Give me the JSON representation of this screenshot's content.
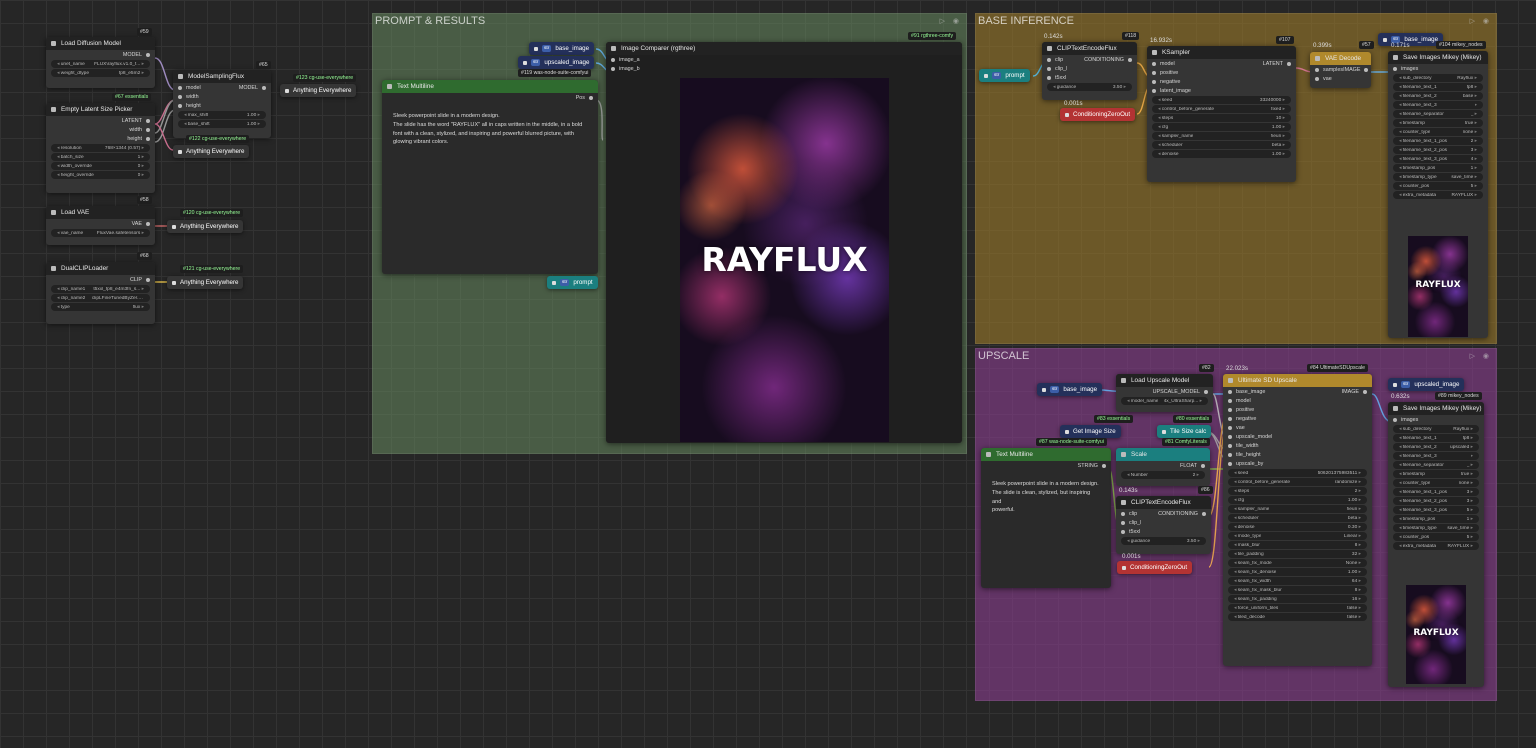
{
  "colors": {
    "prompt_group": "#66885f",
    "base_group": "#9b7a2a",
    "upscale_group": "#8a3d8f",
    "teal": "#1b7f7f",
    "green": "#2f6b2f",
    "purple": "#5b3a9b",
    "red": "#b33333",
    "gold": "#b0892c",
    "navy": "#24305a"
  },
  "groups": {
    "prompt": "PROMPT & RESULTS",
    "base": "BASE INFERENCE",
    "upscale": "UPSCALE"
  },
  "load_model": {
    "id": "#59",
    "title": "Load Diffusion Model",
    "out": "MODEL",
    "w": [
      [
        "unet_name",
        "FLUX\\rayflux.v1.0_f..."
      ],
      [
        "weight_dtype",
        "fp8_e5m2"
      ]
    ]
  },
  "msf": {
    "id": "#65",
    "title": "ModelSamplingFlux",
    "in": [
      "model",
      "width",
      "height"
    ],
    "out": "MODEL",
    "w": [
      [
        "max_shift",
        "1.00"
      ],
      [
        "base_shift",
        "1.00"
      ]
    ]
  },
  "latent": {
    "id": "#67 essentials",
    "title": "Empty Latent Size Picker",
    "out": [
      "LATENT",
      "width",
      "height"
    ],
    "w": [
      [
        "resolution",
        "768×1344 (0.57)"
      ],
      [
        "batch_size",
        "1"
      ],
      [
        "width_override",
        "0"
      ],
      [
        "height_override",
        "0"
      ]
    ]
  },
  "vae": {
    "id": "#58",
    "title": "Load VAE",
    "out": "VAE",
    "w": [
      [
        "vae_name",
        "FluxVae.safetensors"
      ]
    ]
  },
  "clip": {
    "id": "#68",
    "title": "DualCLIPLoader",
    "out": "CLIP",
    "w": [
      [
        "clip_name1",
        "t5xxl_fp8_e4m3fn_s..."
      ],
      [
        "clip_name2",
        "clipLFineTunedByZer..."
      ],
      [
        "type",
        "flux"
      ]
    ]
  },
  "ae": {
    "a": "Anything Everywhere",
    "t123": "#123 cg-use-everywhere",
    "t122": "#122 cg-use-everywhere",
    "t120": "#120 cg-use-everywhere",
    "t121": "#121 cg-use-everywhere"
  },
  "text1": {
    "title": "Text Multiline",
    "out": "Pos",
    "body": "Sleek powerpoint slide in a modern design.\nThe slide has the word \"RAYFLUX\" all in caps written in the middle, in a bold\nfont with a clean, stylized, and inspiring and powerful blurred picture, with\nglowing vibrant colors."
  },
  "chips": {
    "base_image": "base_image",
    "upscaled_image": "upscaled_image",
    "was": "#119 was-node-suite-comfyui",
    "prompt": "prompt",
    "str_tag": "str"
  },
  "comparer": {
    "title": "Image Comparer (rgthree)",
    "id": "#91 rgthree-comfy",
    "a": "image_a",
    "b": "image_b",
    "text": "RAYFLUX"
  },
  "clipenc": {
    "id": "#118",
    "time": "0.142s",
    "title": "CLIPTextEncodeFlux",
    "in": [
      "clip",
      "clip_l",
      "t5xxl"
    ],
    "out": "CONDITIONING",
    "w": [
      [
        "guidance",
        "3.50"
      ]
    ]
  },
  "czo": {
    "title": "ConditioningZeroOut",
    "time": "0.001s"
  },
  "ks": {
    "id": "#107",
    "time": "16.932s",
    "title": "KSampler",
    "in": [
      "model",
      "positive",
      "negative",
      "latent_image"
    ],
    "out": "LATENT",
    "w": [
      [
        "seed",
        "33240000"
      ],
      [
        "control_before_generate",
        "fixed"
      ],
      [
        "steps",
        "10"
      ],
      [
        "cfg",
        "1.00"
      ],
      [
        "sampler_name",
        "heun"
      ],
      [
        "scheduler",
        "beta"
      ],
      [
        "denoise",
        "1.00"
      ]
    ]
  },
  "vaed": {
    "id": "#57",
    "time": "0.399s",
    "title": "VAE Decode",
    "in": [
      "samples",
      "vae"
    ],
    "out": "IMAGE"
  },
  "save1": {
    "id": "#104 mikey_nodes",
    "time": "0.171s",
    "title": "Save Images Mikey (Mikey)",
    "in": "images",
    "w": [
      [
        "sub_directory",
        "Rayflux"
      ],
      [
        "filename_text_1",
        "fp8"
      ],
      [
        "filename_text_2",
        "base"
      ],
      [
        "filename_text_3",
        ""
      ],
      [
        "filename_separator",
        "_"
      ],
      [
        "timestamp",
        "true"
      ],
      [
        "counter_type",
        "none"
      ],
      [
        "filename_text_1_pos",
        "2"
      ],
      [
        "filename_text_2_pos",
        "3"
      ],
      [
        "filename_text_3_pos",
        "4"
      ],
      [
        "timestamp_pos",
        "1"
      ],
      [
        "timestamp_type",
        "save_time"
      ],
      [
        "counter_pos",
        "5"
      ],
      [
        "extra_metadata",
        "RAYFLUX"
      ]
    ],
    "imgtext": "RAYFLUX"
  },
  "upm": {
    "id": "#82",
    "title": "Load Upscale Model",
    "out": "UPSCALE_MODEL",
    "w": [
      [
        "model_name",
        "4x_UltraSharp..."
      ]
    ]
  },
  "gis": {
    "id": "#83 essentials",
    "title": "Get Image Size"
  },
  "tsc": {
    "id": "#80 essentials",
    "title": "Tile Size calc"
  },
  "cl81": "#81 ComfyLiterals",
  "text2": {
    "title": "Text Multiline",
    "id": "#87 was-node-suite-comfyui",
    "out": "STRING",
    "body": "Sleek powerpoint slide in a modern design.\nThe slide is clean, stylized, but inspiring and\npowerful."
  },
  "scale": {
    "title": "Scale",
    "out": "FLOAT",
    "w": [
      [
        "Number",
        "2"
      ]
    ]
  },
  "clipenc2": {
    "id": "#86",
    "time": "0.143s",
    "title": "CLIPTextEncodeFlux",
    "in": [
      "clip",
      "clip_l",
      "t5xxl"
    ],
    "out": "CONDITIONING",
    "w": [
      [
        "guidance",
        "3.50"
      ]
    ]
  },
  "czo2": {
    "title": "ConditioningZeroOut",
    "time": "0.001s"
  },
  "usd": {
    "id": "#84 UltimateSDUpscale",
    "time": "22.023s",
    "title": "Ultimate SD Upscale",
    "in": [
      "base_image",
      "model",
      "positive",
      "negative",
      "vae",
      "upscale_model",
      "tile_width",
      "tile_height",
      "upscale_by"
    ],
    "out": "IMAGE",
    "w": [
      [
        "seed",
        "506201375983511"
      ],
      [
        "control_before_generate",
        "randomize"
      ],
      [
        "steps",
        "2"
      ],
      [
        "cfg",
        "1.00"
      ],
      [
        "sampler_name",
        "heun"
      ],
      [
        "scheduler",
        "beta"
      ],
      [
        "denoise",
        "0.30"
      ],
      [
        "mode_type",
        "Linear"
      ],
      [
        "mask_blur",
        "8"
      ],
      [
        "tile_padding",
        "32"
      ],
      [
        "seam_fix_mode",
        "None"
      ],
      [
        "seam_fix_denoise",
        "1.00"
      ],
      [
        "seam_fix_width",
        "64"
      ],
      [
        "seam_fix_mask_blur",
        "8"
      ],
      [
        "seam_fix_padding",
        "16"
      ],
      [
        "force_uniform_tiles",
        "false"
      ],
      [
        "tiled_decode",
        "false"
      ]
    ]
  },
  "save2": {
    "id": "#89 mikey_nodes",
    "time": "0.632s",
    "title": "Save Images Mikey (Mikey)",
    "in": "images",
    "w": [
      [
        "sub_directory",
        "Rayflux"
      ],
      [
        "filename_text_1",
        "fp8"
      ],
      [
        "filename_text_2",
        "upscaled"
      ],
      [
        "filename_text_3",
        ""
      ],
      [
        "filename_separator",
        "_"
      ],
      [
        "timestamp",
        "true"
      ],
      [
        "counter_type",
        "none"
      ],
      [
        "filename_text_1_pos",
        "3"
      ],
      [
        "filename_text_2_pos",
        "3"
      ],
      [
        "filename_text_3_pos",
        "5"
      ],
      [
        "timestamp_pos",
        "1"
      ],
      [
        "timestamp_type",
        "save_time"
      ],
      [
        "counter_pos",
        "5"
      ],
      [
        "extra_metadata",
        "RAYFLUX"
      ]
    ],
    "imgtext": "RAYFLUX"
  }
}
